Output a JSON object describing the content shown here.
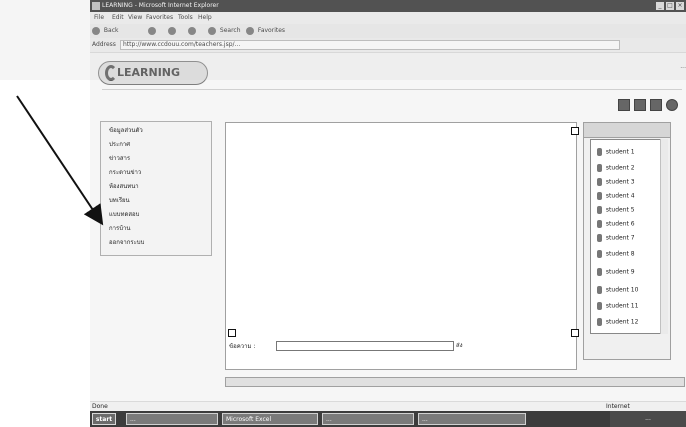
{
  "window": {
    "title": "LEARNING - Microsoft Internet Explorer",
    "menu": [
      "File",
      "Edit",
      "View",
      "Favorites",
      "Tools",
      "Help"
    ],
    "toolbar": {
      "back": "Back",
      "search": "Search",
      "favorites": "Favorites"
    },
    "address": {
      "label": "Address",
      "value": "http://www.ccdouu.com/teachers.jsp/..."
    }
  },
  "page": {
    "logo": "LEARNING",
    "header_right": "...",
    "left_menu": [
      {
        "label": "ข้อมูลส่วนตัว"
      },
      {
        "label": "ประกาศ"
      },
      {
        "label": "ข่าวสาร"
      },
      {
        "label": "กระดานข่าว"
      },
      {
        "label": "ห้องสนทนา"
      },
      {
        "label": "บทเรียน"
      },
      {
        "label": "แบบทดสอบ"
      },
      {
        "label": "การบ้าน"
      },
      {
        "label": "ออกจากระบบ"
      }
    ],
    "content": {
      "message_label": "ข้อความ :",
      "send_label": "ส่ง"
    },
    "right_panel": {
      "items": [
        "student 1",
        "student 2",
        "student 3",
        "student 4",
        "student 5",
        "student 6",
        "student 7",
        "student 8",
        "student 9",
        "student 10",
        "student 11",
        "student 12"
      ]
    }
  },
  "status": {
    "left": "Done",
    "right": "Internet"
  },
  "taskbar": {
    "start": "start",
    "tasks": [
      "...",
      "Microsoft Excel",
      "...",
      "..."
    ],
    "tray": "..."
  },
  "annotation": {
    "arrow_color": "#111111"
  }
}
